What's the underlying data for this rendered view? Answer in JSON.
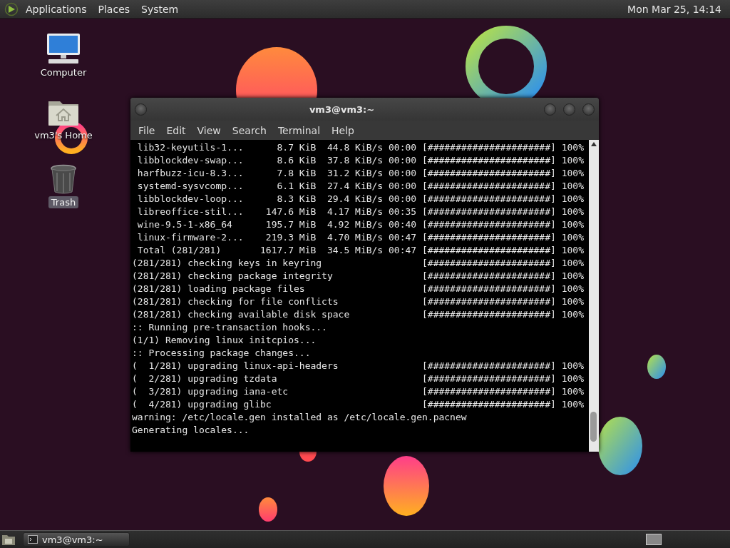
{
  "top_panel": {
    "menus": [
      "Applications",
      "Places",
      "System"
    ],
    "clock": "Mon Mar 25, 14:14"
  },
  "desktop_icons": [
    {
      "label": "Computer",
      "kind": "computer",
      "selected": false
    },
    {
      "label": "vm3's Home",
      "kind": "home",
      "selected": false
    },
    {
      "label": "Trash",
      "kind": "trash",
      "selected": true
    }
  ],
  "terminal": {
    "title": "vm3@vm3:~",
    "menu": [
      "File",
      "Edit",
      "View",
      "Search",
      "Terminal",
      "Help"
    ],
    "lines": [
      " lib32-keyutils-1...      8.7 KiB  44.8 KiB/s 00:00 [######################] 100%",
      " libblockdev-swap...      8.6 KiB  37.8 KiB/s 00:00 [######################] 100%",
      " harfbuzz-icu-8.3...      7.8 KiB  31.2 KiB/s 00:00 [######################] 100%",
      " systemd-sysvcomp...      6.1 KiB  27.4 KiB/s 00:00 [######################] 100%",
      " libblockdev-loop...      8.3 KiB  29.4 KiB/s 00:00 [######################] 100%",
      " libreoffice-stil...    147.6 MiB  4.17 MiB/s 00:35 [######################] 100%",
      " wine-9.5-1-x86_64      195.7 MiB  4.92 MiB/s 00:40 [######################] 100%",
      " linux-firmware-2...    219.3 MiB  4.70 MiB/s 00:47 [######################] 100%",
      " Total (281/281)       1617.7 MiB  34.5 MiB/s 00:47 [######################] 100%",
      "(281/281) checking keys in keyring                  [######################] 100%",
      "(281/281) checking package integrity                [######################] 100%",
      "(281/281) loading package files                     [######################] 100%",
      "(281/281) checking for file conflicts               [######################] 100%",
      "(281/281) checking available disk space             [######################] 100%",
      ":: Running pre-transaction hooks...",
      "(1/1) Removing linux initcpios...",
      ":: Processing package changes...",
      "(  1/281) upgrading linux-api-headers               [######################] 100%",
      "(  2/281) upgrading tzdata                          [######################] 100%",
      "(  3/281) upgrading iana-etc                        [######################] 100%",
      "(  4/281) upgrading glibc                           [######################] 100%",
      "warning: /etc/locale.gen installed as /etc/locale.gen.pacnew",
      "Generating locales..."
    ]
  },
  "taskbar": {
    "tasks": [
      {
        "label": "vm3@vm3:~",
        "selected": false
      }
    ]
  }
}
